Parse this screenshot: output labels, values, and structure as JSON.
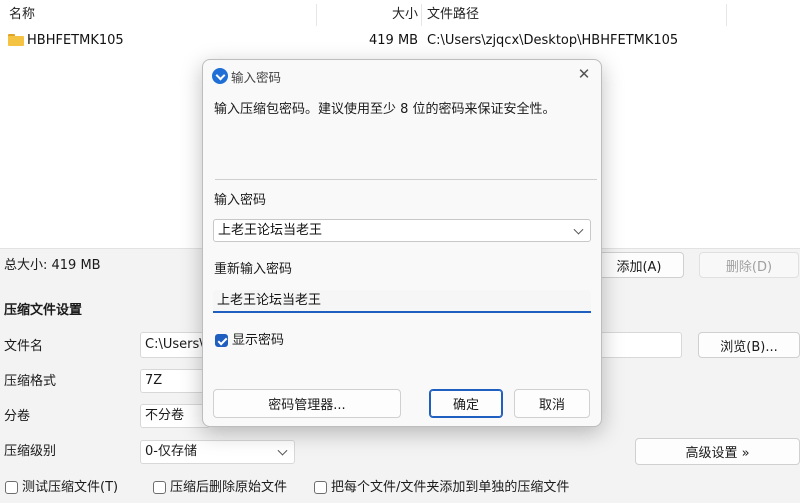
{
  "file_list": {
    "columns": {
      "name": "名称",
      "size": "大小",
      "path": "文件路径"
    },
    "rows": [
      {
        "name": "HBHFETMK105",
        "size": "419 MB",
        "path": "C:\\Users\\zjqcx\\Desktop\\HBHFETMK105"
      }
    ]
  },
  "summary": {
    "total_size": "总大小: 419 MB"
  },
  "buttons": {
    "add": "添加(A)",
    "delete": "删除(D)",
    "browse": "浏览(B)...",
    "advanced": "高级设置 »"
  },
  "settings": {
    "section_title": "压缩文件设置",
    "filename_label": "文件名",
    "filename_value": "C:\\Users\\",
    "format_label": "压缩格式",
    "format_value": "7Z",
    "split_label": "分卷",
    "split_value": "不分卷",
    "level_label": "压缩级别",
    "level_value": "0-仅存储"
  },
  "options": {
    "test": "测试压缩文件(T)",
    "delete_after": "压缩后删除原始文件",
    "separate": "把每个文件/文件夹添加到单独的压缩文件"
  },
  "dialog": {
    "title": "输入密码",
    "description": "输入压缩包密码。建议使用至少 8 位的密码来保证安全性。",
    "password_label": "输入密码",
    "password_value": "上老王论坛当老王",
    "reenter_label": "重新输入密码",
    "reenter_value": "上老王论坛当老王",
    "show_password_label": "显示密码",
    "manager_button": "密码管理器...",
    "ok_button": "确定",
    "cancel_button": "取消",
    "close_glyph": "✕"
  }
}
